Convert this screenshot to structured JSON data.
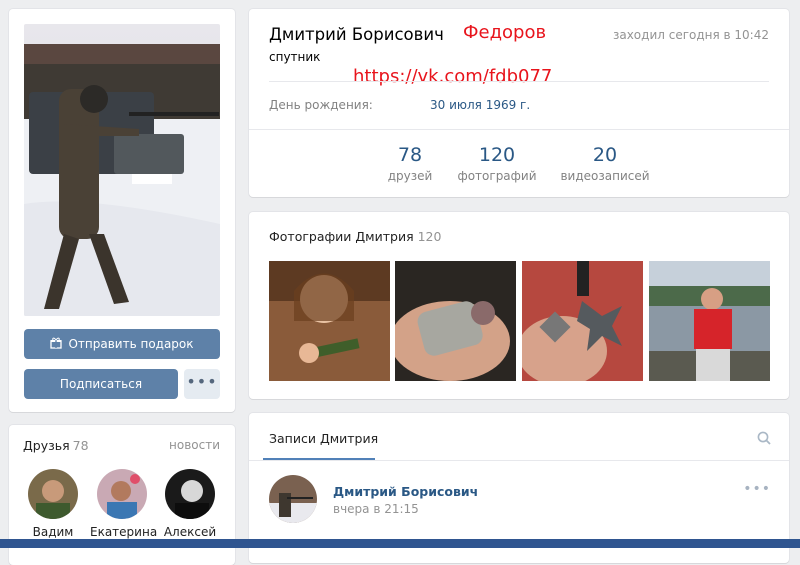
{
  "profile": {
    "name": "Дмитрий Борисович",
    "surname_overlay": "Федоров",
    "status": "заходил сегодня в 10:42",
    "subtitle": "спутник",
    "url_overlay": "https://vk.com/fdb077",
    "birthday_label": "День рождения:",
    "birthday_value": "30 июля 1969 г."
  },
  "stats": [
    {
      "value": "78",
      "label": "друзей"
    },
    {
      "value": "120",
      "label": "фотографий"
    },
    {
      "value": "20",
      "label": "видеозаписей"
    }
  ],
  "left": {
    "gift_button": "Отправить подарок",
    "subscribe_button": "Подписаться",
    "more_button": "•••"
  },
  "friends": {
    "title": "Друзья",
    "count": "78",
    "news_link": "новости",
    "items": [
      {
        "name": "Вадим"
      },
      {
        "name": "Екатерина"
      },
      {
        "name": "Алексей"
      }
    ]
  },
  "photos": {
    "title": "Фотографии Дмитрия",
    "count": "120"
  },
  "wall": {
    "tab_label": "Записи Дмитрия",
    "post": {
      "author": "Дмитрий Борисович",
      "time": "вчера в 21:15",
      "menu": "•••"
    }
  },
  "icons": {
    "gift": "gift-icon",
    "search": "search-icon",
    "more": "more-dots-icon"
  },
  "colors": {
    "accent": "#5e81a8",
    "link": "#2a5885",
    "overlay_red": "#e8141c"
  }
}
